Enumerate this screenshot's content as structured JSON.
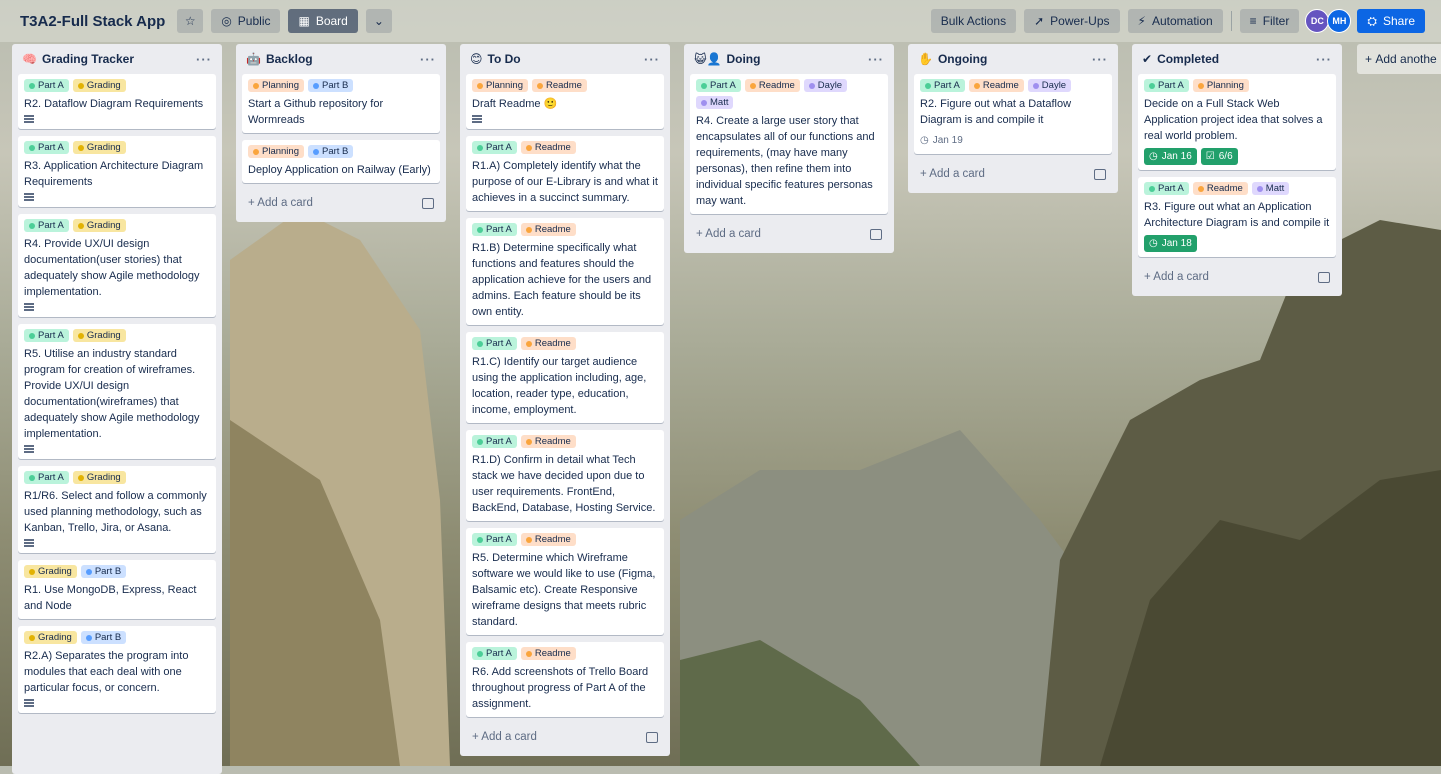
{
  "board": {
    "title": "T3A2-Full Stack App",
    "visibility_label": "Public",
    "view_label": "Board",
    "bulk_actions_label": "Bulk Actions",
    "powerups_label": "Power-Ups",
    "automation_label": "Automation",
    "filter_label": "Filter",
    "share_label": "Share",
    "add_list_label": "Add anothe",
    "members": [
      "DC",
      "MH"
    ],
    "add_card_label": "Add a card"
  },
  "colors": {
    "green": "#baf3db",
    "green_dot": "#4bce97",
    "yellow": "#f8e6a0",
    "yellow_dot": "#e2b203",
    "orange": "#fedec8",
    "orange_dot": "#faa53d",
    "blue": "#cce0ff",
    "blue_dot": "#579dff",
    "purple": "#dfd8fd",
    "purple_dot": "#9f8fef"
  },
  "lists": [
    {
      "title": "Grading Tracker",
      "icon": "brain-emoji",
      "cards": [
        {
          "labels": [
            {
              "text": "Part A",
              "color": "green"
            },
            {
              "text": "Grading",
              "color": "yellow"
            }
          ],
          "title": "R2. Dataflow Diagram Requirements",
          "desc": true
        },
        {
          "labels": [
            {
              "text": "Part A",
              "color": "green"
            },
            {
              "text": "Grading",
              "color": "yellow"
            }
          ],
          "title": "R3. Application Architecture Diagram Requirements",
          "desc": true
        },
        {
          "labels": [
            {
              "text": "Part A",
              "color": "green"
            },
            {
              "text": "Grading",
              "color": "yellow"
            }
          ],
          "title": "R4. Provide UX/UI design documentation(user stories) that adequately show Agile methodology implementation.",
          "desc": true
        },
        {
          "labels": [
            {
              "text": "Part A",
              "color": "green"
            },
            {
              "text": "Grading",
              "color": "yellow"
            }
          ],
          "title": "R5. Utilise an industry standard program for creation of wireframes. Provide UX/UI design documentation(wireframes) that adequately show Agile methodology implementation.",
          "desc": true
        },
        {
          "labels": [
            {
              "text": "Part A",
              "color": "green"
            },
            {
              "text": "Grading",
              "color": "yellow"
            }
          ],
          "title": "R1/R6. Select and follow a commonly used planning methodology, such as Kanban, Trello, Jira, or Asana.",
          "desc": true
        },
        {
          "labels": [
            {
              "text": "Grading",
              "color": "yellow"
            },
            {
              "text": "Part B",
              "color": "blue"
            }
          ],
          "title": "R1. Use MongoDB, Express, React and Node",
          "desc": false
        },
        {
          "labels": [
            {
              "text": "Grading",
              "color": "yellow"
            },
            {
              "text": "Part B",
              "color": "blue"
            }
          ],
          "title": "R2.A) Separates the program into modules that each deal with one particular focus, or concern.",
          "desc": true
        }
      ]
    },
    {
      "title": "Backlog",
      "icon": "robot-emoji",
      "cards": [
        {
          "labels": [
            {
              "text": "Planning",
              "color": "orange"
            },
            {
              "text": "Part B",
              "color": "blue"
            }
          ],
          "title": "Start a Github repository for Wormreads",
          "desc": false
        },
        {
          "labels": [
            {
              "text": "Planning",
              "color": "orange"
            },
            {
              "text": "Part B",
              "color": "blue"
            }
          ],
          "title": "Deploy Application on Railway (Early)",
          "desc": false
        }
      ]
    },
    {
      "title": "To Do",
      "icon": "smiley-emoji",
      "cards": [
        {
          "labels": [
            {
              "text": "Planning",
              "color": "orange"
            },
            {
              "text": "Readme",
              "color": "orange"
            }
          ],
          "title": "Draft Readme 🙂",
          "desc": true
        },
        {
          "labels": [
            {
              "text": "Part A",
              "color": "green"
            },
            {
              "text": "Readme",
              "color": "orange"
            }
          ],
          "title": "R1.A) Completely identify what the purpose of our E-Library is and what it achieves in a succinct summary.",
          "desc": false
        },
        {
          "labels": [
            {
              "text": "Part A",
              "color": "green"
            },
            {
              "text": "Readme",
              "color": "orange"
            }
          ],
          "title": "R1.B) Determine specifically what functions and features should the application achieve for the users and admins. Each feature should be its own entity.",
          "desc": false
        },
        {
          "labels": [
            {
              "text": "Part A",
              "color": "green"
            },
            {
              "text": "Readme",
              "color": "orange"
            }
          ],
          "title": "R1.C) Identify our target audience using the application including, age, location, reader type, education, income, employment.",
          "desc": false
        },
        {
          "labels": [
            {
              "text": "Part A",
              "color": "green"
            },
            {
              "text": "Readme",
              "color": "orange"
            }
          ],
          "title": "R1.D) Confirm in detail what Tech stack we have decided upon due to user requirements. FrontEnd, BackEnd, Database, Hosting Service.",
          "desc": false
        },
        {
          "labels": [
            {
              "text": "Part A",
              "color": "green"
            },
            {
              "text": "Readme",
              "color": "orange"
            }
          ],
          "title": "R5. Determine which Wireframe software we would like to use (Figma, Balsamic etc). Create Responsive wireframe designs that meets rubric standard.",
          "desc": false
        },
        {
          "labels": [
            {
              "text": "Part A",
              "color": "green"
            },
            {
              "text": "Readme",
              "color": "orange"
            }
          ],
          "title": "R6. Add screenshots of Trello Board throughout progress of Part A of the assignment.",
          "desc": false
        }
      ]
    },
    {
      "title": "Doing",
      "icon": "cat-person-emoji",
      "cards": [
        {
          "labels": [
            {
              "text": "Part A",
              "color": "green"
            },
            {
              "text": "Readme",
              "color": "orange"
            },
            {
              "text": "Dayle",
              "color": "purple"
            },
            {
              "text": "Matt",
              "color": "purple"
            }
          ],
          "title": "R4. Create a large user story that encapsulates all of our functions and requirements, (may have many personas), then refine them into individual specific features personas may want.",
          "desc": false
        }
      ]
    },
    {
      "title": "Ongoing",
      "icon": "hand-emoji",
      "cards": [
        {
          "labels": [
            {
              "text": "Part A",
              "color": "green"
            },
            {
              "text": "Readme",
              "color": "orange"
            },
            {
              "text": "Dayle",
              "color": "purple"
            }
          ],
          "title": "R2. Figure out what a Dataflow Diagram is and compile it",
          "desc": false,
          "due": "Jan 19",
          "due_style": "plain"
        }
      ]
    },
    {
      "title": "Completed",
      "icon": "check-emoji",
      "cards": [
        {
          "labels": [
            {
              "text": "Part A",
              "color": "green"
            },
            {
              "text": "Planning",
              "color": "orange"
            }
          ],
          "title": "Decide on a Full Stack Web Application project idea that solves a real world problem.",
          "desc": false,
          "due": "Jan 16",
          "due_style": "done",
          "checklist": "6/6"
        },
        {
          "labels": [
            {
              "text": "Part A",
              "color": "green"
            },
            {
              "text": "Readme",
              "color": "orange"
            },
            {
              "text": "Matt",
              "color": "purple"
            }
          ],
          "title": "R3. Figure out what an Application Architecture Diagram is and compile it",
          "desc": false,
          "due": "Jan 18",
          "due_style": "done"
        }
      ]
    }
  ]
}
